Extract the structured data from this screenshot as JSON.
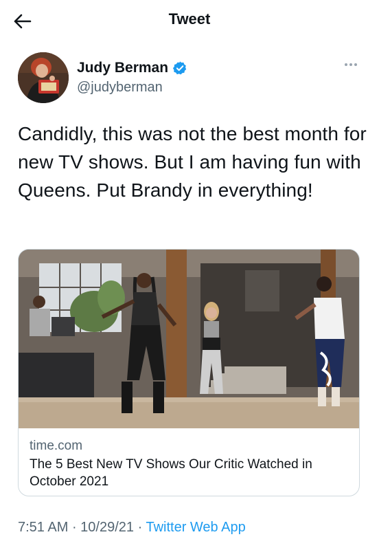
{
  "header": {
    "title": "Tweet",
    "back_icon": "arrow-left-icon"
  },
  "author": {
    "name": "Judy Berman",
    "handle": "@judyberman",
    "verified_icon": "verified-badge-icon",
    "verified_color": "#1d9bf0"
  },
  "tweet": {
    "text": "Candidly, this was not the best month for new TV shows. But I am having fun with Queens. Put Brandy in everything!"
  },
  "card": {
    "domain": "time.com",
    "title": "The 5 Best New TV Shows Our Critic Watched in October 2021"
  },
  "meta": {
    "time": "7:51 AM",
    "separator1": " · ",
    "date": "10/29/21",
    "separator2": " · ",
    "source": "Twitter Web App"
  },
  "colors": {
    "accent": "#1d9bf0",
    "secondary_text": "#536471",
    "border": "#cfd9de"
  }
}
